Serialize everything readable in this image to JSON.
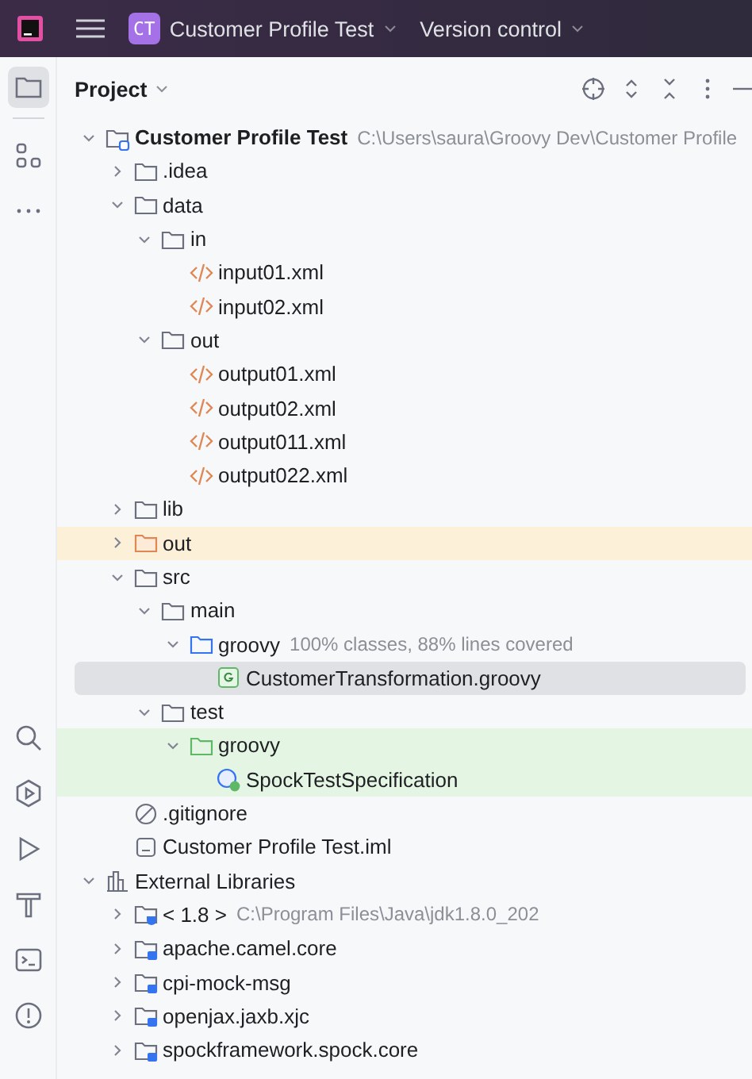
{
  "title_bar": {
    "project_badge": "CT",
    "project": "Customer Profile Test",
    "vcs": "Version control"
  },
  "tool_window": {
    "title": "Project"
  },
  "tree": [
    {
      "label": "Customer Profile Test",
      "kind": "module",
      "hint": "C:\\Users\\saura\\Groovy Dev\\Customer Profile",
      "expanded": true,
      "selected": false,
      "children": [
        {
          "label": ".idea",
          "kind": "folder",
          "expanded": false,
          "selected": false
        },
        {
          "label": "data",
          "kind": "folder",
          "expanded": true,
          "selected": false,
          "children": [
            {
              "label": "in",
              "kind": "folder",
              "expanded": true,
              "selected": false,
              "children": [
                {
                  "label": "input01.xml",
                  "kind": "xml",
                  "selected": false
                },
                {
                  "label": "input02.xml",
                  "kind": "xml",
                  "selected": false
                }
              ]
            },
            {
              "label": "out",
              "kind": "folder",
              "expanded": true,
              "selected": false,
              "children": [
                {
                  "label": "output01.xml",
                  "kind": "xml",
                  "selected": false
                },
                {
                  "label": "output02.xml",
                  "kind": "xml",
                  "selected": false
                },
                {
                  "label": "output011.xml",
                  "kind": "xml",
                  "selected": false
                },
                {
                  "label": "output022.xml",
                  "kind": "xml",
                  "selected": false
                }
              ]
            }
          ]
        },
        {
          "label": "lib",
          "kind": "folder",
          "expanded": false,
          "selected": false
        },
        {
          "label": "out",
          "kind": "excluded-folder",
          "expanded": false,
          "selected": false
        },
        {
          "label": "src",
          "kind": "folder",
          "expanded": true,
          "selected": false,
          "children": [
            {
              "label": "main",
              "kind": "folder",
              "expanded": true,
              "selected": false,
              "children": [
                {
                  "label": "groovy",
                  "kind": "source-folder",
                  "hint": "100% classes, 88% lines covered",
                  "expanded": true,
                  "selected": false,
                  "children": [
                    {
                      "label": "CustomerTransformation.groovy",
                      "kind": "groovy",
                      "selected": true
                    }
                  ]
                }
              ]
            },
            {
              "label": "test",
              "kind": "folder",
              "expanded": true,
              "selected": false,
              "children": [
                {
                  "label": "groovy",
                  "kind": "test-folder",
                  "expanded": true,
                  "selected": false,
                  "children": [
                    {
                      "label": "SpockTestSpecification",
                      "kind": "spock-test",
                      "selected": false
                    }
                  ]
                }
              ]
            }
          ]
        },
        {
          "label": ".gitignore",
          "kind": "ignored",
          "selected": false
        },
        {
          "label": "Customer Profile Test.iml",
          "kind": "iml",
          "selected": false
        }
      ]
    },
    {
      "label": "External Libraries",
      "kind": "libraries",
      "expanded": true,
      "selected": false,
      "children": [
        {
          "label": "< 1.8 >",
          "kind": "jdk",
          "hint": "C:\\Program Files\\Java\\jdk1.8.0_202",
          "expanded": false,
          "selected": false
        },
        {
          "label": "apache.camel.core",
          "kind": "library",
          "expanded": false,
          "selected": false
        },
        {
          "label": "cpi-mock-msg",
          "kind": "library",
          "expanded": false,
          "selected": false
        },
        {
          "label": "openjax.jaxb.xjc",
          "kind": "library",
          "expanded": false,
          "selected": false
        },
        {
          "label": "spockframework.spock.core",
          "kind": "library",
          "expanded": false,
          "selected": false
        }
      ]
    }
  ]
}
